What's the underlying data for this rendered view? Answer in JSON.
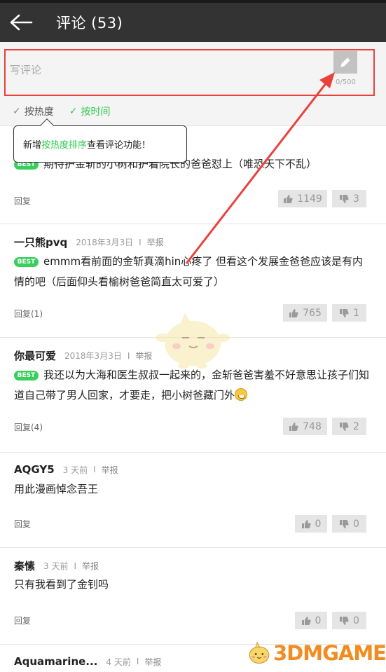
{
  "header": {
    "title": "评论 (53)"
  },
  "composer": {
    "placeholder": "写评论",
    "char_count": "0/500"
  },
  "sort": {
    "hot": "按热度",
    "time": "按时间"
  },
  "tooltip": {
    "before": "新增",
    "highlight": "按热度排序",
    "after": "查看评论功能！"
  },
  "comments": [
    {
      "body": "期待护金斩的小树和护着院长的爸爸怼上（唯恐天下不乱）",
      "best": "BEST",
      "reply": "回复",
      "likes": "1149",
      "dislikes": "3"
    },
    {
      "user": "一只熊pvq",
      "time": "2018年3月3日",
      "sep": "I",
      "report": "举报",
      "best": "BEST",
      "body": "emmm看前面的金斩真滴hin心疼了 但看这个发展金爸爸应该是有内情的吧（后面仰头看榆树爸爸简直太可爱了）",
      "reply": "回复(1)",
      "likes": "765",
      "dislikes": "1"
    },
    {
      "user": "你最可爱",
      "time": "2018年3月3日",
      "sep": "I",
      "report": "举报",
      "best": "BEST",
      "body": "我还以为大海和医生叔叔一起来的，金斩爸爸害羞不好意思让孩子们知道自己带了男人回家，才要走，把小树爸藏门外",
      "reply": "回复(4)",
      "likes": "748",
      "dislikes": "2"
    },
    {
      "user": "AQGY5",
      "time": "3 天前",
      "sep": "I",
      "report": "举报",
      "body": "用此漫画悼念吾王",
      "reply": "回复",
      "likes": "0",
      "dislikes": "0"
    },
    {
      "user": "秦愫",
      "time": "3 天前",
      "sep": "I",
      "report": "举报",
      "body": "只有我看到了金钊吗",
      "reply": "回复",
      "likes": "0",
      "dislikes": "0"
    },
    {
      "user": "Aquamarine...",
      "time": "4 天前",
      "sep": "I",
      "report": "举报"
    }
  ],
  "watermark": {
    "text": "3DMGAME"
  },
  "colors": {
    "header_bg": "#333333",
    "accent_green": "#2fc84e",
    "highlight_red": "#e8423b",
    "vote_bg": "#e5e5e5"
  }
}
